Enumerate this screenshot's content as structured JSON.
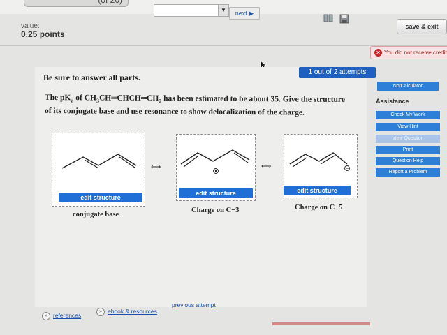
{
  "header": {
    "question_number": "(of 20)",
    "next_label": "next ▶",
    "save_exit_label": "save & exit",
    "value_label": "value:",
    "points_label": "0.25 points",
    "credit_message": "You did not receive credit f"
  },
  "question": {
    "instruction": "Be sure to answer all parts.",
    "attempts": "1 out of 2 attempts",
    "line1_pre": "The pK",
    "line1_sub": "a",
    "line1_mid": " of CH",
    "line1_sub2": "3",
    "line1_mid2": "CH═CHCH═CH",
    "line1_sub3": "2",
    "line1_post": " has been estimated to be about 35. Give the structure",
    "line2": "of its conjugate base and use resonance to show delocalization of the charge."
  },
  "structures": [
    {
      "edit_label": "edit structure",
      "caption": "conjugate base"
    },
    {
      "edit_label": "edit structure",
      "caption": "Charge on C−3"
    },
    {
      "edit_label": "edit structure",
      "caption": "Charge on C−5"
    }
  ],
  "resonance_arrow": "⟷",
  "sidebar": {
    "not_calculator": "NotCalculator",
    "assistance_title": "Assistance",
    "buttons": [
      {
        "label": "Check My Work",
        "enabled": true
      },
      {
        "label": "View Hint",
        "enabled": true
      },
      {
        "label": "View Question",
        "enabled": false
      },
      {
        "label": "Print",
        "enabled": true
      },
      {
        "label": "Question Help",
        "enabled": true
      },
      {
        "label": "Report a Problem",
        "enabled": true
      }
    ]
  },
  "footer": {
    "references": "references",
    "ebook": "ebook & resources",
    "previous": "previous attempt"
  },
  "colors": {
    "accent_blue": "#1f6fd6",
    "error_red": "#c82727"
  }
}
